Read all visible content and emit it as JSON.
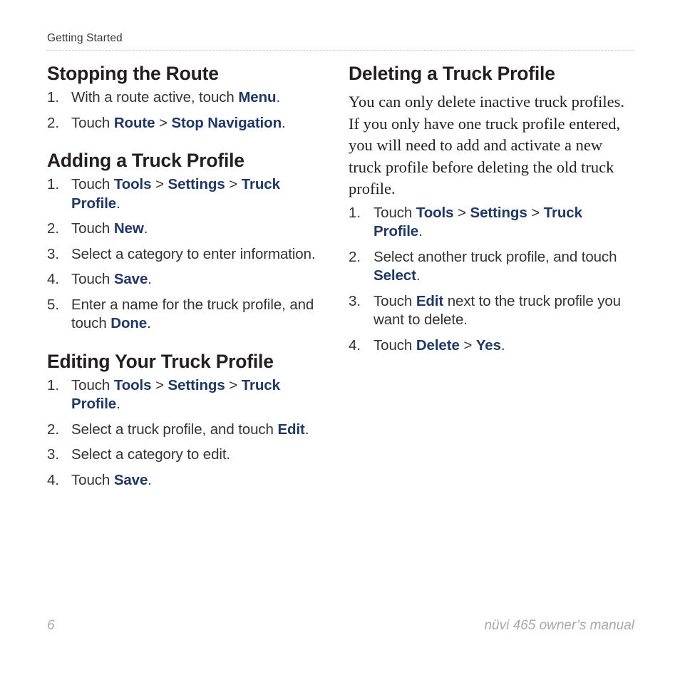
{
  "header": {
    "running_head": "Getting Started"
  },
  "footer": {
    "page_number": "6",
    "manual_title": "nüvi 465 owner’s manual"
  },
  "colors": {
    "ui_term": "#203864",
    "heading": "#231f20",
    "body": "#333336",
    "footer": "#a7a9ac",
    "rule": "#c2c2c4"
  },
  "columns": {
    "left": [
      {
        "id": "stopping-the-route",
        "title": "Stopping the Route",
        "steps": [
          [
            {
              "t": "text",
              "v": "With a route active, touch "
            },
            {
              "t": "ui",
              "v": "Menu"
            },
            {
              "t": "text",
              "v": "."
            }
          ],
          [
            {
              "t": "text",
              "v": "Touch "
            },
            {
              "t": "ui",
              "v": "Route"
            },
            {
              "t": "sep",
              "v": " > "
            },
            {
              "t": "ui",
              "v": "Stop Navigation"
            },
            {
              "t": "text",
              "v": "."
            }
          ]
        ]
      },
      {
        "id": "adding-a-truck-profile",
        "title": "Adding a Truck Profile",
        "steps": [
          [
            {
              "t": "text",
              "v": "Touch "
            },
            {
              "t": "ui",
              "v": "Tools"
            },
            {
              "t": "sep",
              "v": " > "
            },
            {
              "t": "ui",
              "v": "Settings"
            },
            {
              "t": "sep",
              "v": " > "
            },
            {
              "t": "ui",
              "v": "Truck Profile"
            },
            {
              "t": "text",
              "v": "."
            }
          ],
          [
            {
              "t": "text",
              "v": "Touch "
            },
            {
              "t": "ui",
              "v": "New"
            },
            {
              "t": "text",
              "v": "."
            }
          ],
          [
            {
              "t": "text",
              "v": "Select a category to enter information."
            }
          ],
          [
            {
              "t": "text",
              "v": "Touch "
            },
            {
              "t": "ui",
              "v": "Save"
            },
            {
              "t": "text",
              "v": "."
            }
          ],
          [
            {
              "t": "text",
              "v": "Enter a name for the truck profile, and touch "
            },
            {
              "t": "ui",
              "v": "Done"
            },
            {
              "t": "text",
              "v": "."
            }
          ]
        ]
      },
      {
        "id": "editing-your-truck-profile",
        "title": "Editing Your Truck Profile",
        "steps": [
          [
            {
              "t": "text",
              "v": "Touch "
            },
            {
              "t": "ui",
              "v": "Tools"
            },
            {
              "t": "sep",
              "v": " > "
            },
            {
              "t": "ui",
              "v": "Settings"
            },
            {
              "t": "sep",
              "v": " > "
            },
            {
              "t": "ui",
              "v": "Truck Profile"
            },
            {
              "t": "text",
              "v": "."
            }
          ],
          [
            {
              "t": "text",
              "v": "Select a truck profile, and touch "
            },
            {
              "t": "ui",
              "v": "Edit"
            },
            {
              "t": "text",
              "v": "."
            }
          ],
          [
            {
              "t": "text",
              "v": "Select a category to edit."
            }
          ],
          [
            {
              "t": "text",
              "v": "Touch "
            },
            {
              "t": "ui",
              "v": "Save"
            },
            {
              "t": "text",
              "v": "."
            }
          ]
        ]
      }
    ],
    "right": [
      {
        "id": "deleting-a-truck-profile",
        "title": "Deleting a Truck Profile",
        "paragraph": "You can only delete inactive truck profiles. If you only have one truck profile entered, you will need to add and activate a new truck profile before deleting the old truck profile.",
        "steps": [
          [
            {
              "t": "text",
              "v": "Touch "
            },
            {
              "t": "ui",
              "v": "Tools"
            },
            {
              "t": "sep",
              "v": " > "
            },
            {
              "t": "ui",
              "v": "Settings"
            },
            {
              "t": "sep",
              "v": " > "
            },
            {
              "t": "ui",
              "v": "Truck Profile"
            },
            {
              "t": "text",
              "v": "."
            }
          ],
          [
            {
              "t": "text",
              "v": "Select another truck profile, and touch "
            },
            {
              "t": "ui",
              "v": "Select"
            },
            {
              "t": "text",
              "v": "."
            }
          ],
          [
            {
              "t": "text",
              "v": "Touch "
            },
            {
              "t": "ui",
              "v": "Edit"
            },
            {
              "t": "text",
              "v": " next to the truck profile you want to delete."
            }
          ],
          [
            {
              "t": "text",
              "v": "Touch "
            },
            {
              "t": "ui",
              "v": "Delete"
            },
            {
              "t": "sep",
              "v": " > "
            },
            {
              "t": "ui",
              "v": "Yes"
            },
            {
              "t": "text",
              "v": "."
            }
          ]
        ]
      }
    ]
  }
}
